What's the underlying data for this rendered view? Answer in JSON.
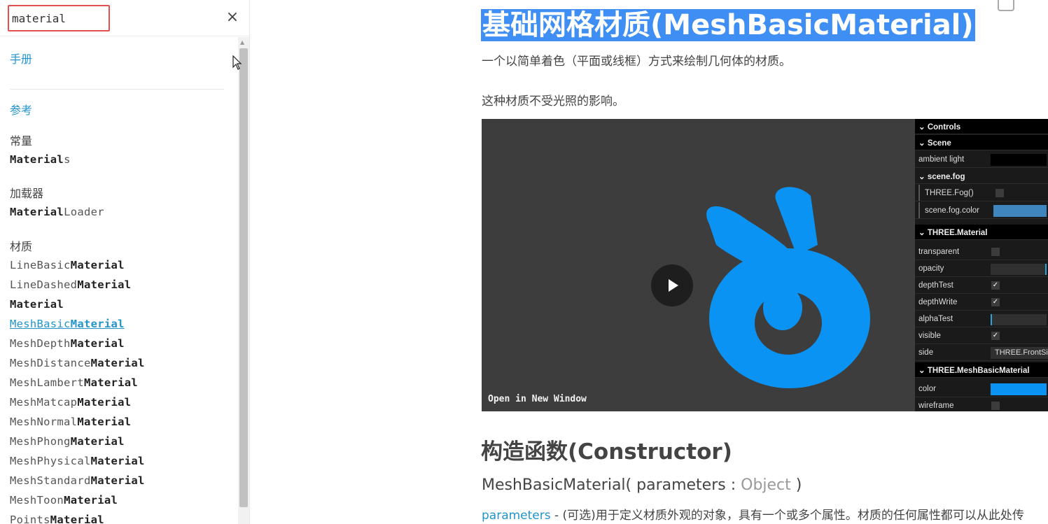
{
  "search": {
    "value": "material"
  },
  "sidebar": {
    "close_glyph": "×",
    "sections": [
      {
        "label": "手册"
      },
      {
        "label": "参考"
      }
    ],
    "categories": [
      {
        "label": "常量",
        "items": [
          {
            "pre": "",
            "bold": "Material",
            "post": "s"
          }
        ]
      },
      {
        "label": "加载器",
        "items": [
          {
            "pre": "",
            "bold": "Material",
            "post": "Loader"
          }
        ]
      },
      {
        "label": "材质",
        "items": [
          {
            "pre": "LineBasic",
            "bold": "Material",
            "post": ""
          },
          {
            "pre": "LineDashed",
            "bold": "Material",
            "post": ""
          },
          {
            "pre": "",
            "bold": "Material",
            "post": ""
          },
          {
            "pre": "MeshBasic",
            "bold": "Material",
            "post": ""
          },
          {
            "pre": "MeshDepth",
            "bold": "Material",
            "post": ""
          },
          {
            "pre": "MeshDistance",
            "bold": "Material",
            "post": ""
          },
          {
            "pre": "MeshLambert",
            "bold": "Material",
            "post": ""
          },
          {
            "pre": "MeshMatcap",
            "bold": "Material",
            "post": ""
          },
          {
            "pre": "MeshNormal",
            "bold": "Material",
            "post": ""
          },
          {
            "pre": "MeshPhong",
            "bold": "Material",
            "post": ""
          },
          {
            "pre": "MeshPhysical",
            "bold": "Material",
            "post": ""
          },
          {
            "pre": "MeshStandard",
            "bold": "Material",
            "post": ""
          },
          {
            "pre": "MeshToon",
            "bold": "Material",
            "post": ""
          },
          {
            "pre": "Points",
            "bold": "Material",
            "post": ""
          }
        ]
      }
    ]
  },
  "main": {
    "title": "基础网格材质(MeshBasicMaterial)",
    "desc1": "一个以简单着色（平面或线框）方式来绘制几何体的材质。",
    "desc2": "这种材质不受光照的影响。",
    "video": {
      "open_new_window": "Open in New Window"
    },
    "gui": {
      "controls": "Controls",
      "scene": "Scene",
      "ambient_light": "ambient light",
      "scene_fog": "scene.fog",
      "three_fog": "THREE.Fog()",
      "scene_fog_color": "scene.fog.color",
      "three_material": "THREE.Material",
      "transparent": "transparent",
      "opacity": "opacity",
      "depth_test": "depthTest",
      "depth_write": "depthWrite",
      "alpha_test": "alphaTest",
      "visible": "visible",
      "side": "side",
      "side_value": "THREE.FrontSide",
      "mesh_basic_material": "THREE.MeshBasicMaterial",
      "color": "color",
      "wireframe": "wireframe",
      "checked_glyph": "✓"
    },
    "constructor_heading": "构造函数(Constructor)",
    "signature": {
      "name": "MeshBasicMaterial( parameters : ",
      "type": "Object",
      "end": " )"
    },
    "param_line": {
      "name": "parameters",
      "text": " - (可选)用于定义材质外观的对象，具有一个或多个属性。材质的任何属性都可以从此处传"
    }
  },
  "colors": {
    "accent_link": "#2194ce",
    "highlight": "#3f8ef3",
    "mesh_blue": "#0a93f3",
    "fog_color": "#3f86bf",
    "search_border": "#e2504f"
  }
}
